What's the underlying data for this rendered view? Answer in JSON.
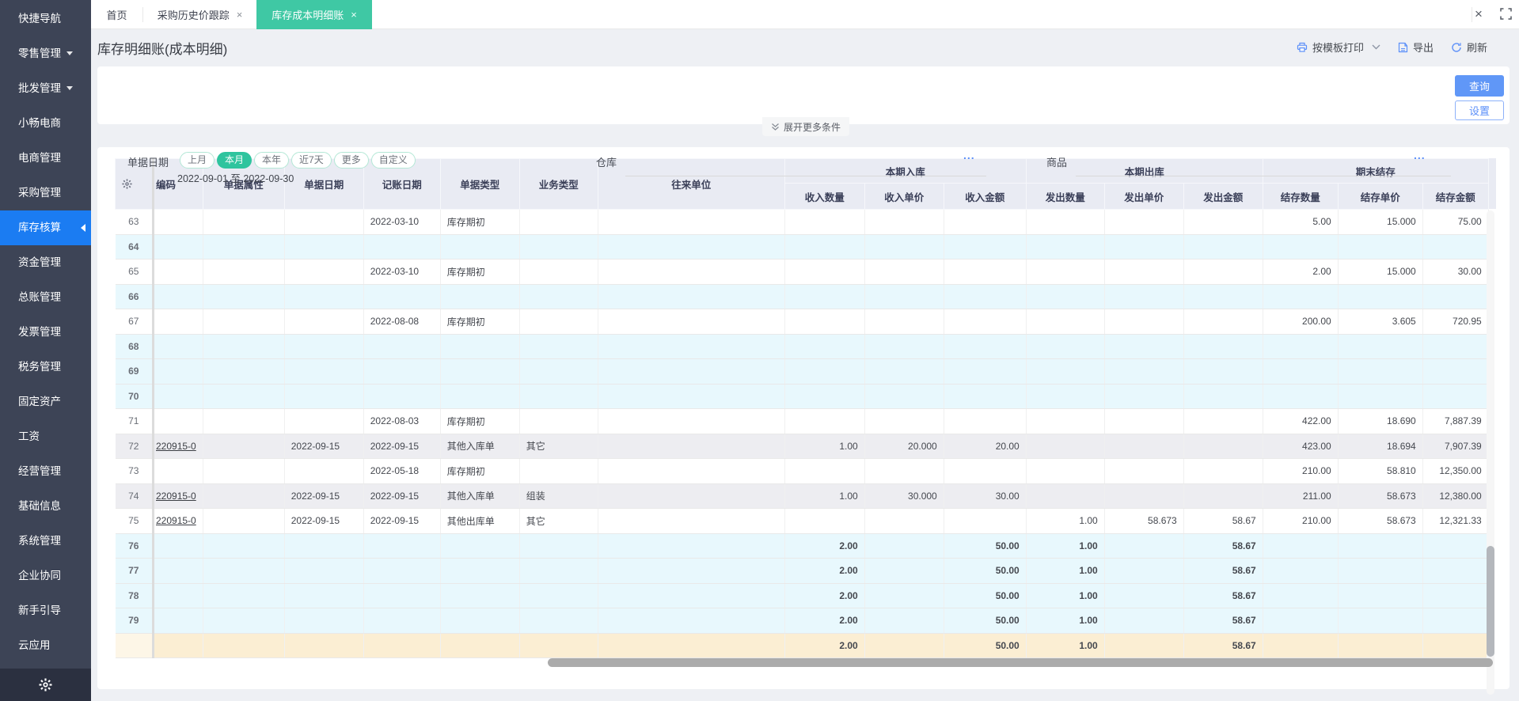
{
  "colors": {
    "sidebar_bg": "#3d4456",
    "sidebar_active": "#1b7cf2",
    "tab_active": "#3fc8a4",
    "pill_active": "#2fc49e",
    "query_btn": "#6097f7",
    "header_bg": "#e9ebf3",
    "row_blue": "#e8f8fd",
    "row_gray": "#ededf1",
    "row_tan": "#fbeed3",
    "icon_blue": "#5b8ff9"
  },
  "sidebar": {
    "items": [
      {
        "label": "快捷导航"
      },
      {
        "label": "零售管理",
        "caret": true
      },
      {
        "label": "批发管理",
        "caret": true
      },
      {
        "label": "小畅电商"
      },
      {
        "label": "电商管理"
      },
      {
        "label": "采购管理"
      },
      {
        "label": "库存核算",
        "active": true
      },
      {
        "label": "资金管理"
      },
      {
        "label": "总账管理"
      },
      {
        "label": "发票管理"
      },
      {
        "label": "税务管理"
      },
      {
        "label": "固定资产"
      },
      {
        "label": "工资"
      },
      {
        "label": "经营管理"
      },
      {
        "label": "基础信息"
      },
      {
        "label": "系统管理"
      },
      {
        "label": "企业协同"
      },
      {
        "label": "新手引导"
      },
      {
        "label": "云应用"
      }
    ]
  },
  "tabs": [
    {
      "label": "首页",
      "closable": false
    },
    {
      "label": "采购历史价跟踪",
      "closable": true
    },
    {
      "label": "库存成本明细账",
      "closable": true,
      "active": true
    }
  ],
  "window_controls": {
    "close": "×"
  },
  "page": {
    "title": "库存明细账(成本明细)"
  },
  "toolbar": [
    {
      "icon": "printer-icon",
      "label": "按模板打印",
      "chevron": true
    },
    {
      "icon": "export-icon",
      "label": "导出"
    },
    {
      "icon": "refresh-icon",
      "label": "刷新"
    }
  ],
  "filters": {
    "date_label": "单据日期",
    "pills": [
      "上月",
      "本月",
      "本年",
      "近7天",
      "更多",
      "自定义"
    ],
    "active_pill": "本月",
    "date_range": "2022-09-01 至 2022-09-30",
    "warehouse_label": "仓库",
    "product_label": "商品",
    "ellipsis": "...",
    "query_label": "查询",
    "settings_label": "设置",
    "expand_label": "展开更多条件"
  },
  "table": {
    "single_headers": [
      "",
      "编码",
      "单据属性",
      "单据日期",
      "记账日期",
      "单据类型",
      "业务类型",
      "往来单位"
    ],
    "groups": [
      "本期入库",
      "本期出库",
      "期末结存"
    ],
    "sub_headers": [
      "收入数量",
      "收入单价",
      "收入金额",
      "发出数量",
      "发出单价",
      "发出金额",
      "结存数量",
      "结存单价",
      "结存金额"
    ],
    "rows": [
      {
        "bg": "w",
        "cells": [
          "63",
          "",
          "",
          "",
          "2022-03-10",
          "库存期初",
          "",
          "",
          "",
          "",
          "",
          "",
          "",
          "",
          "5.00",
          "15.000",
          "75.00"
        ]
      },
      {
        "bg": "b",
        "cells": [
          "64",
          "",
          "",
          "",
          "",
          "",
          "",
          "",
          "",
          "",
          "",
          "",
          "",
          "",
          "",
          "",
          ""
        ]
      },
      {
        "bg": "w",
        "cells": [
          "65",
          "",
          "",
          "",
          "2022-03-10",
          "库存期初",
          "",
          "",
          "",
          "",
          "",
          "",
          "",
          "",
          "2.00",
          "15.000",
          "30.00"
        ]
      },
      {
        "bg": "b",
        "cells": [
          "66",
          "",
          "",
          "",
          "",
          "",
          "",
          "",
          "",
          "",
          "",
          "",
          "",
          "",
          "",
          "",
          ""
        ]
      },
      {
        "bg": "w",
        "cells": [
          "67",
          "",
          "",
          "",
          "2022-08-08",
          "库存期初",
          "",
          "",
          "",
          "",
          "",
          "",
          "",
          "",
          "200.00",
          "3.605",
          "720.95"
        ]
      },
      {
        "bg": "b",
        "cells": [
          "68",
          "",
          "",
          "",
          "",
          "",
          "",
          "",
          "",
          "",
          "",
          "",
          "",
          "",
          "",
          "",
          ""
        ]
      },
      {
        "bg": "b",
        "cells": [
          "69",
          "",
          "",
          "",
          "",
          "",
          "",
          "",
          "",
          "",
          "",
          "",
          "",
          "",
          "",
          "",
          ""
        ]
      },
      {
        "bg": "b",
        "cells": [
          "70",
          "",
          "",
          "",
          "",
          "",
          "",
          "",
          "",
          "",
          "",
          "",
          "",
          "",
          "",
          "",
          ""
        ]
      },
      {
        "bg": "w",
        "cells": [
          "71",
          "",
          "",
          "",
          "2022-08-03",
          "库存期初",
          "",
          "",
          "",
          "",
          "",
          "",
          "",
          "",
          "422.00",
          "18.690",
          "7,887.39"
        ]
      },
      {
        "bg": "g",
        "cells": [
          "72",
          "220915-0",
          "",
          "2022-09-15",
          "2022-09-15",
          "其他入库单",
          "其它",
          "",
          "1.00",
          "20.000",
          "20.00",
          "",
          "",
          "",
          "423.00",
          "18.694",
          "7,907.39"
        ]
      },
      {
        "bg": "w",
        "cells": [
          "73",
          "",
          "",
          "",
          "2022-05-18",
          "库存期初",
          "",
          "",
          "",
          "",
          "",
          "",
          "",
          "",
          "210.00",
          "58.810",
          "12,350.00"
        ]
      },
      {
        "bg": "g",
        "cells": [
          "74",
          "220915-0",
          "",
          "2022-09-15",
          "2022-09-15",
          "其他入库单",
          "组装",
          "",
          "1.00",
          "30.000",
          "30.00",
          "",
          "",
          "",
          "211.00",
          "58.673",
          "12,380.00"
        ]
      },
      {
        "bg": "w",
        "cells": [
          "75",
          "220915-0",
          "",
          "2022-09-15",
          "2022-09-15",
          "其他出库单",
          "其它",
          "",
          "",
          "",
          "",
          "1.00",
          "58.673",
          "58.67",
          "210.00",
          "58.673",
          "12,321.33"
        ]
      },
      {
        "bg": "b",
        "bold": true,
        "cells": [
          "76",
          "",
          "",
          "",
          "",
          "",
          "",
          "",
          "2.00",
          "",
          "50.00",
          "1.00",
          "",
          "58.67",
          "",
          "",
          ""
        ]
      },
      {
        "bg": "b",
        "bold": true,
        "cells": [
          "77",
          "",
          "",
          "",
          "",
          "",
          "",
          "",
          "2.00",
          "",
          "50.00",
          "1.00",
          "",
          "58.67",
          "",
          "",
          ""
        ]
      },
      {
        "bg": "b",
        "bold": true,
        "cells": [
          "78",
          "",
          "",
          "",
          "",
          "",
          "",
          "",
          "2.00",
          "",
          "50.00",
          "1.00",
          "",
          "58.67",
          "",
          "",
          ""
        ]
      },
      {
        "bg": "b",
        "bold": true,
        "cells": [
          "79",
          "",
          "",
          "",
          "",
          "",
          "",
          "",
          "2.00",
          "",
          "50.00",
          "1.00",
          "",
          "58.67",
          "",
          "",
          ""
        ]
      },
      {
        "bg": "t",
        "bold": true,
        "cells": [
          "",
          "",
          "",
          "",
          "",
          "",
          "",
          "",
          "2.00",
          "",
          "50.00",
          "1.00",
          "",
          "58.67",
          "",
          "",
          ""
        ]
      }
    ]
  }
}
